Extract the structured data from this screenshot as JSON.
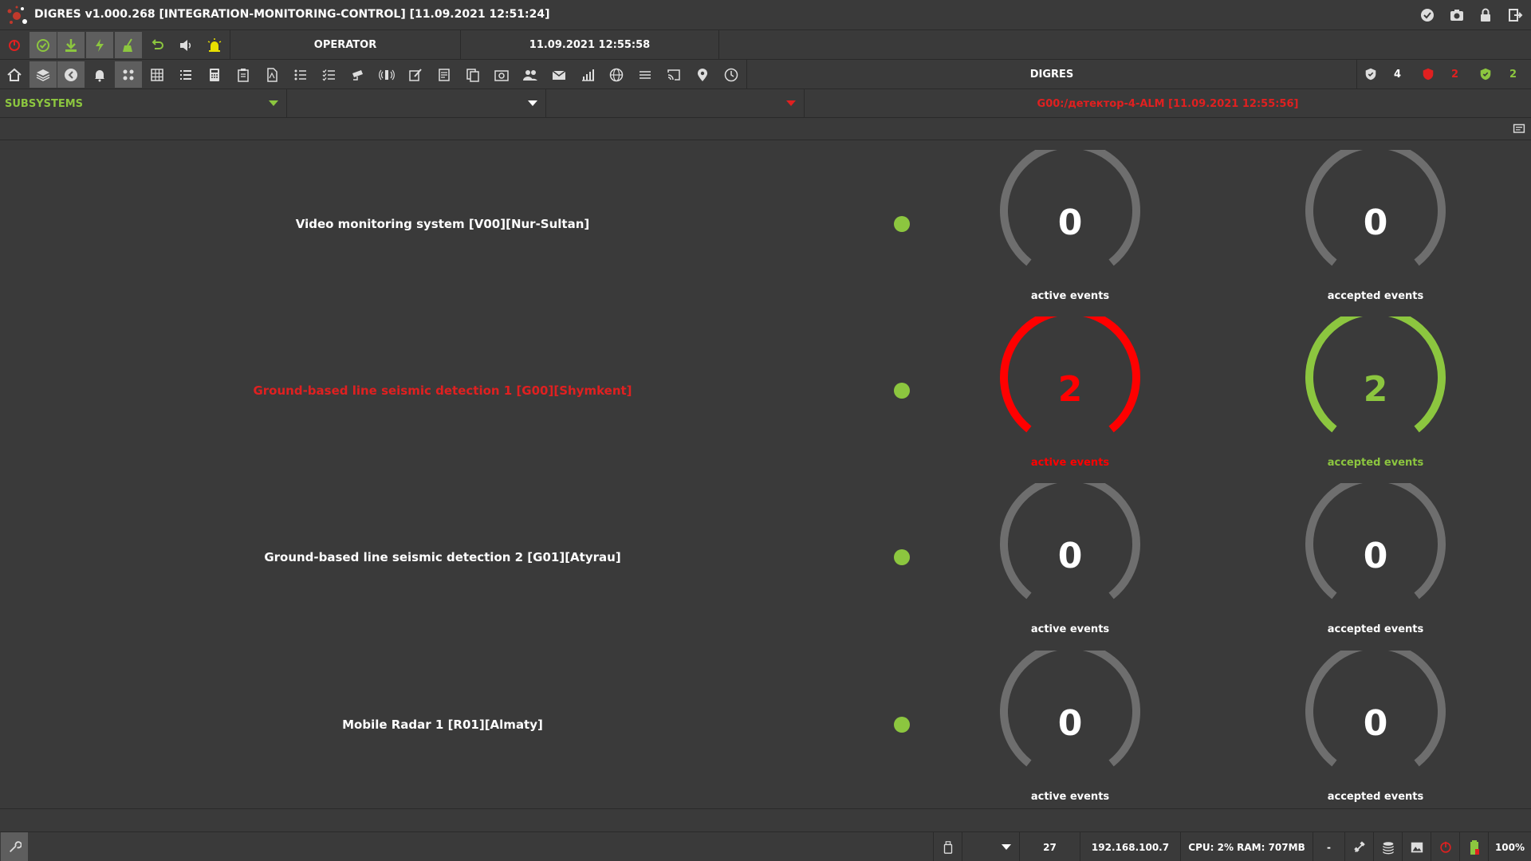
{
  "titlebar": {
    "title": "DIGRES v1.000.268 [INTEGRATION-MONITORING-CONTROL] [11.09.2021 12:51:24]"
  },
  "toolbar1": {
    "operator": "OPERATOR",
    "datetime": "11.09.2021 12:55:58"
  },
  "toolbar2": {
    "system_name": "DIGRES",
    "counter_white": "4",
    "counter_red": "2",
    "counter_green": "2"
  },
  "filters": {
    "subsystems_label": "SUBSYSTEMS",
    "filter2_value": "",
    "filter3_value": "",
    "alarm_text": "G00:/детектор-4-ALM [11.09.2021 12:55:56]"
  },
  "colors": {
    "accent_green": "#8cc63f",
    "alarm_red": "#ff0000",
    "gauge_gray": "#6e6e6e"
  },
  "subsystems": [
    {
      "name": "Video monitoring system [V00][Nur-Sultan]",
      "status": "ok",
      "active": "0",
      "accepted": "0",
      "active_label": "active events",
      "accepted_label": "accepted events"
    },
    {
      "name": "Ground-based line seismic detection 1 [G00][Shymkent]",
      "status": "alarm",
      "active": "2",
      "accepted": "2",
      "active_label": "active events",
      "accepted_label": "accepted events"
    },
    {
      "name": "Ground-based line seismic detection 2 [G01][Atyrau]",
      "status": "ok",
      "active": "0",
      "accepted": "0",
      "active_label": "active events",
      "accepted_label": "accepted events"
    },
    {
      "name": "Mobile Radar 1 [R01][Almaty]",
      "status": "ok",
      "active": "0",
      "accepted": "0",
      "active_label": "active events",
      "accepted_label": "accepted events"
    }
  ],
  "statusbar": {
    "count": "27",
    "ip": "192.168.100.7",
    "resources": "CPU: 2% RAM: 707MB",
    "dash": "-",
    "zoom": "100%"
  }
}
